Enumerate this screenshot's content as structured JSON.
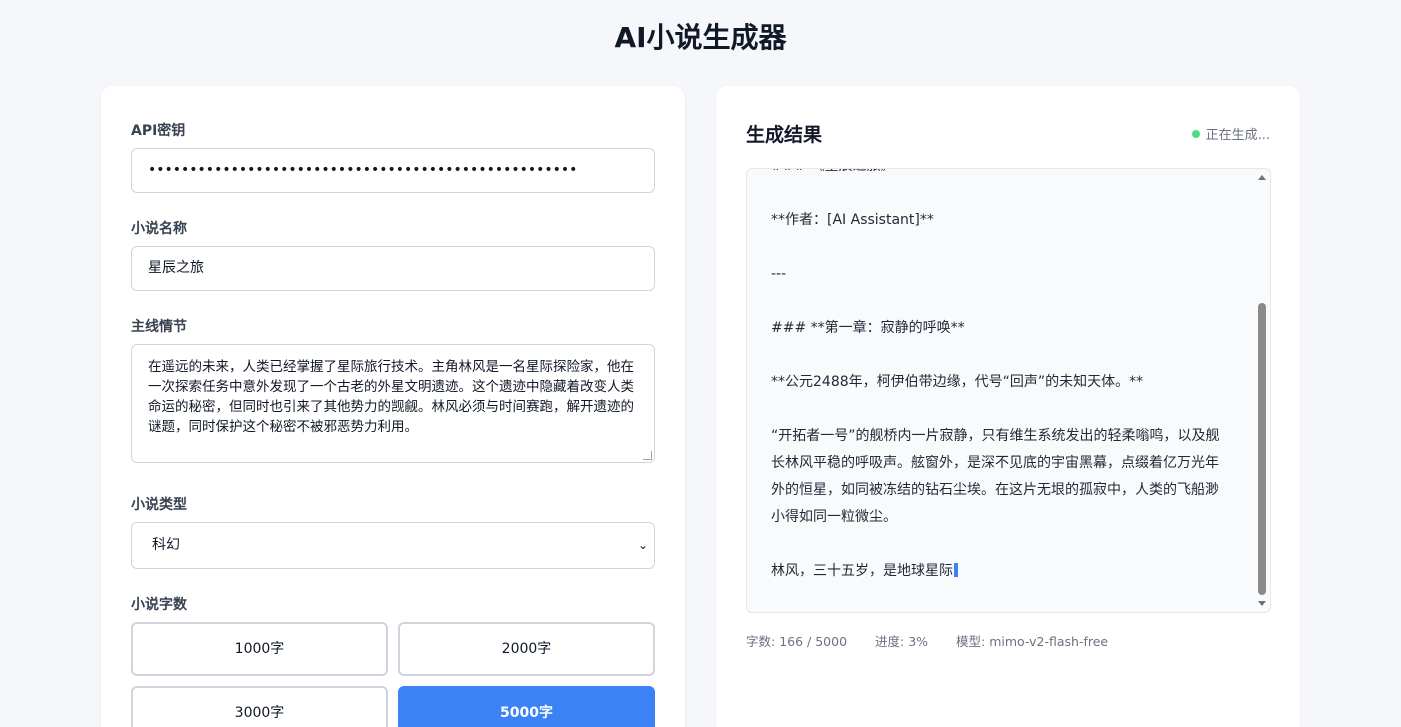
{
  "header": {
    "title": "AI小说生成器"
  },
  "form": {
    "api_key_label": "API密钥",
    "api_key_value": "••••••••••••••••••••••••••••••••••••••••••••••••••••",
    "name_label": "小说名称",
    "name_value": "星辰之旅",
    "plot_label": "主线情节",
    "plot_value": "在遥远的未来，人类已经掌握了星际旅行技术。主角林风是一名星际探险家，他在一次探索任务中意外发现了一个古老的外星文明遗迹。这个遗迹中隐藏着改变人类命运的秘密，但同时也引来了其他势力的觊觎。林风必须与时间赛跑，解开遗迹的谜题，同时保护这个秘密不被邪恶势力利用。",
    "genre_label": "小说类型",
    "genre_value": "科幻",
    "wordcount_label": "小说字数",
    "wordcount_options": [
      "1000字",
      "2000字",
      "3000字",
      "5000字"
    ],
    "wordcount_selected": "5000字"
  },
  "result": {
    "title": "生成结果",
    "status": "正在生成...",
    "lines": [
      "### 《星辰之旅》",
      "**作者：[AI Assistant]**",
      "---",
      "### **第一章：寂静的呼唤**",
      "**公元2488年，柯伊伯带边缘，代号“回声”的未知天体。**",
      "“开拓者一号”的舰桥内一片寂静，只有维生系统发出的轻柔嗡鸣，以及舰长林风平稳的呼吸声。舷窗外，是深不见底的宇宙黑幕，点缀着亿万光年外的恒星，如同被冻结的钻石尘埃。在这片无垠的孤寂中，人类的飞船渺小得如同一粒微尘。",
      "林风，三十五岁，是地球星际"
    ],
    "stats": {
      "words_label": "字数:",
      "words_value": "166 / 5000",
      "progress_label": "进度:",
      "progress_value": "3%",
      "model_label": "模型:",
      "model_value": "mimo-v2-flash-free"
    }
  },
  "colors": {
    "accent": "#3b82f6",
    "status_dot": "#4ade80"
  }
}
